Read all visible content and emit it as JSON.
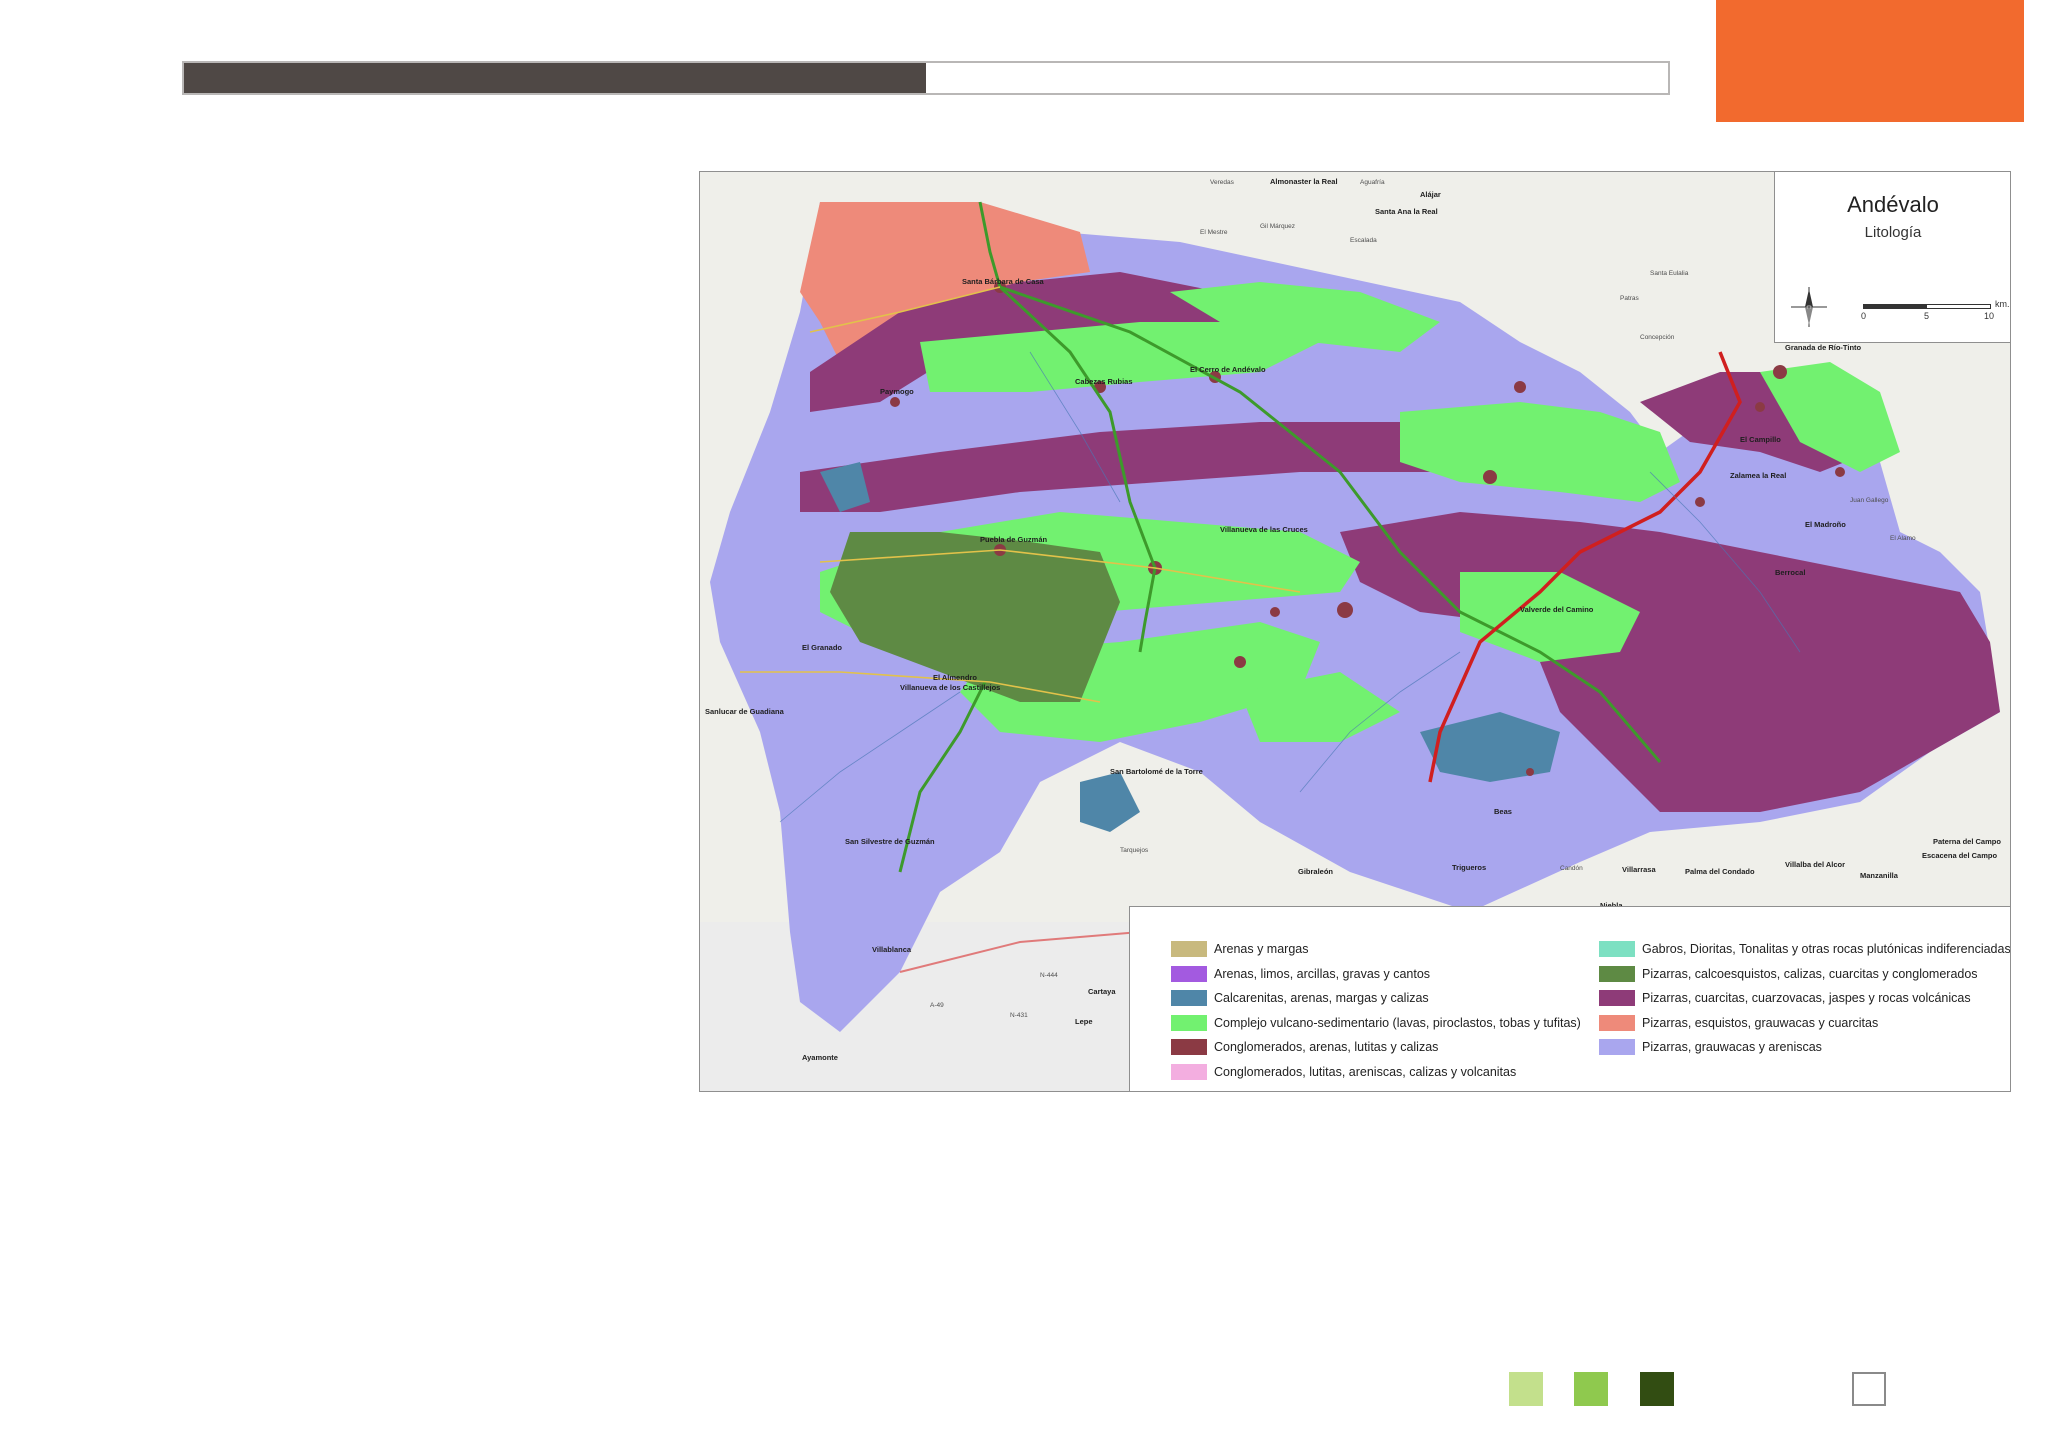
{
  "header": {
    "progress_fraction": 0.5,
    "bar_color": "#4f4845",
    "accent_color": "#f26a2e"
  },
  "map": {
    "title": "Andévalo",
    "subtitle": "Litología",
    "scale": {
      "labels": [
        "0",
        "5",
        "10"
      ],
      "unit": "km."
    },
    "places": [
      "Almonaster la Real",
      "Alájar",
      "Santa Ana la Real",
      "Aguafría",
      "Veredas",
      "El Mestre",
      "Santa Bárbara de Casa",
      "Paymogo",
      "Cabezas Rubias",
      "El Cerro de Andévalo",
      "Granada de Río-Tinto",
      "El Campillo",
      "Zalamea la Real",
      "El Madroño",
      "Berrocal",
      "Villanueva de las Cruces",
      "Puebla de Guzmán",
      "El Granado",
      "Sanlucar de Guadiana",
      "El Almendro",
      "Villanueva de los Castillejos",
      "Valverde del Camino",
      "San Bartolomé de la Torre",
      "San Silvestre de Guzmán",
      "Villablanca",
      "Beas",
      "Gibraleón",
      "Trigueros",
      "Villarrasa",
      "Palma del Condado",
      "Villalba del Alcor",
      "Paterna del Campo",
      "Escacena del Campo",
      "Manzanilla",
      "Cartaya",
      "Lepe",
      "Ayamonte",
      "Niebla",
      "El Alamo",
      "Juan Gallego",
      "Tarquejos",
      "Candón",
      "Gil Márquez",
      "Escalada",
      "Santa Eulalia",
      "Patras",
      "Concepción"
    ],
    "roads": [
      "A-49",
      "N-431",
      "N-444"
    ]
  },
  "legend": {
    "left": [
      {
        "label": "Arenas y margas",
        "color": "#c8b97e"
      },
      {
        "label": "Arenas, limos, arcillas, gravas y cantos",
        "color": "#a35ae0"
      },
      {
        "label": "Calcarenitas, arenas, margas y calizas",
        "color": "#4f86a8"
      },
      {
        "label": "Complejo vulcano-sedimentario (lavas, piroclastos, tobas y tufitas)",
        "color": "#72f170"
      },
      {
        "label": "Conglomerados, arenas, lutitas y calizas",
        "color": "#8b3a44"
      },
      {
        "label": "Conglomerados, lutitas, areniscas, calizas y volcanitas",
        "color": "#f3aee0"
      }
    ],
    "right": [
      {
        "label": "Gabros, Dioritas, Tonalitas y otras rocas plutónicas indiferenciadas",
        "color": "#7de0c2"
      },
      {
        "label": "Pizarras, calcoesquistos, calizas, cuarcitas y conglomerados",
        "color": "#5e8a44"
      },
      {
        "label": "Pizarras, cuarcitas, cuarzovacas, jaspes y rocas volcánicas",
        "color": "#8e3b78"
      },
      {
        "label": "Pizarras, esquistos, grauwacas y cuarcitas",
        "color": "#ee8a7a"
      },
      {
        "label": "Pizarras, grauwacas y areniscas",
        "color": "#a9a6ee"
      }
    ]
  },
  "footer": {
    "squares": [
      "#c3e08c",
      "#8fc94e",
      "#324d12",
      "#ffffff"
    ]
  }
}
